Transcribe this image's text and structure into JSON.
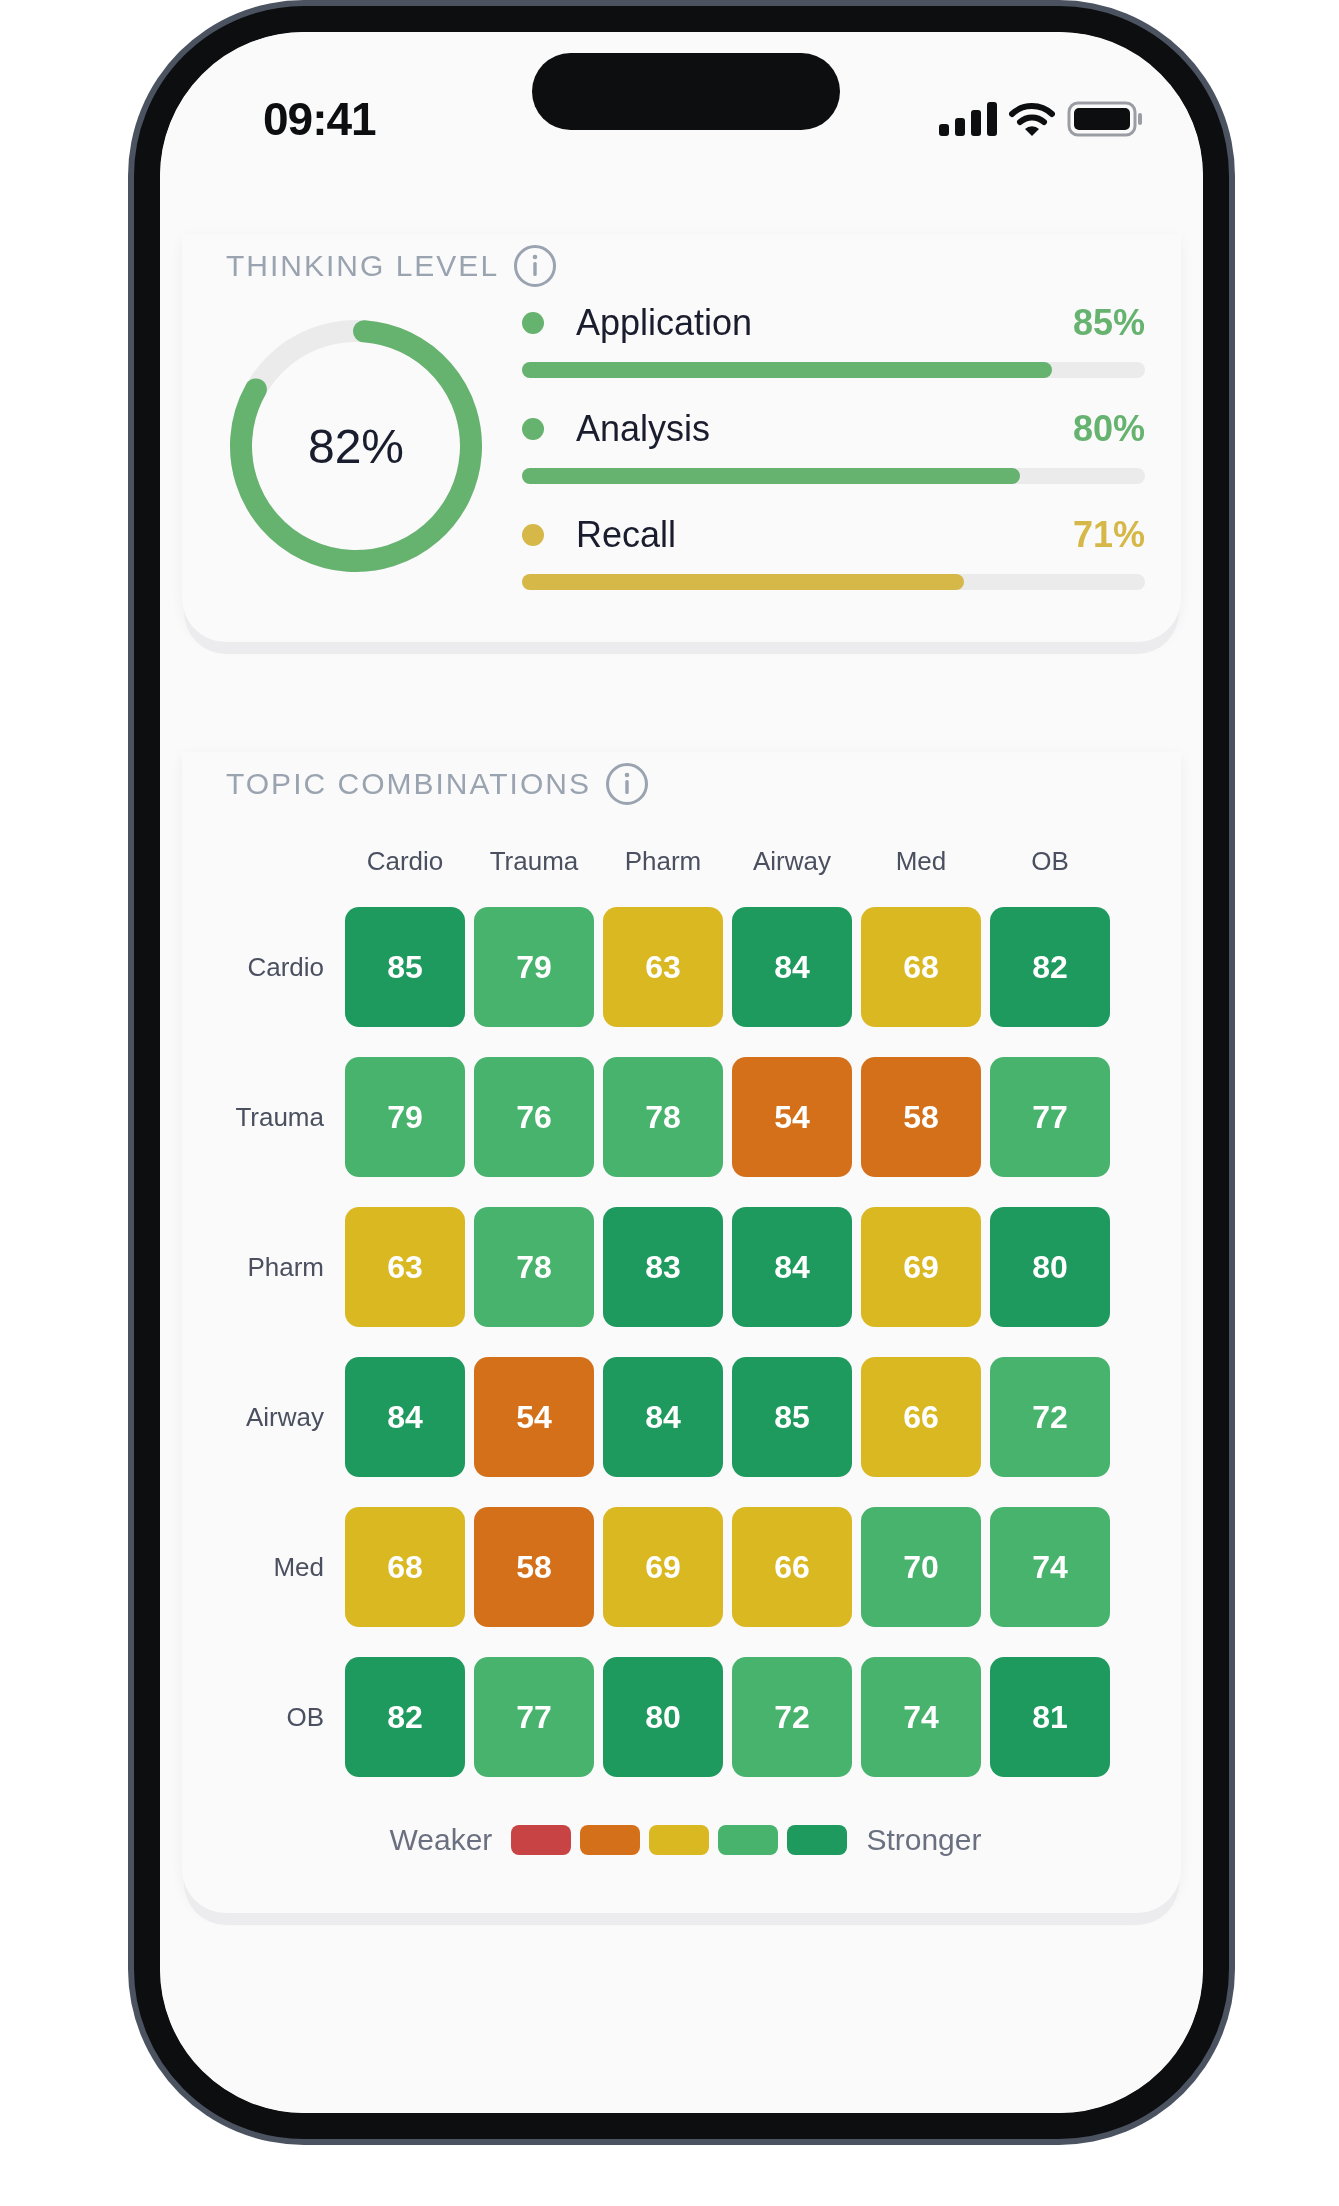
{
  "status_bar": {
    "time": "09:41"
  },
  "thinking_level": {
    "title": "THINKING LEVEL",
    "overall": {
      "label": "82%",
      "level": 0.82
    },
    "items": [
      {
        "label": "Application",
        "value": "85%",
        "level": 0.85,
        "color": "#66b26f"
      },
      {
        "label": "Analysis",
        "value": "80%",
        "level": 0.8,
        "color": "#66b26f"
      },
      {
        "label": "Recall",
        "value": "71%",
        "level": 0.71,
        "color": "#d6b848"
      }
    ]
  },
  "topic_combinations": {
    "title": "TOPIC COMBINATIONS",
    "columns": [
      "Cardio",
      "Trauma",
      "Pharm",
      "Airway",
      "Med",
      "OB"
    ],
    "rows": [
      {
        "label": "Cardio",
        "cells": [
          {
            "value": "85",
            "color": "#1e9a5e"
          },
          {
            "value": "79",
            "color": "#47b36d"
          },
          {
            "value": "63",
            "color": "#d9b822"
          },
          {
            "value": "84",
            "color": "#1e9a5e"
          },
          {
            "value": "68",
            "color": "#d9b822"
          },
          {
            "value": "82",
            "color": "#1e9a5e"
          }
        ]
      },
      {
        "label": "Trauma",
        "cells": [
          {
            "value": "79",
            "color": "#47b36d"
          },
          {
            "value": "76",
            "color": "#47b36d"
          },
          {
            "value": "78",
            "color": "#47b36d"
          },
          {
            "value": "54",
            "color": "#d4701a"
          },
          {
            "value": "58",
            "color": "#d4701a"
          },
          {
            "value": "77",
            "color": "#47b36d"
          }
        ]
      },
      {
        "label": "Pharm",
        "cells": [
          {
            "value": "63",
            "color": "#d9b822"
          },
          {
            "value": "78",
            "color": "#47b36d"
          },
          {
            "value": "83",
            "color": "#1e9a5e"
          },
          {
            "value": "84",
            "color": "#1e9a5e"
          },
          {
            "value": "69",
            "color": "#d9b822"
          },
          {
            "value": "80",
            "color": "#1e9a5e"
          }
        ]
      },
      {
        "label": "Airway",
        "cells": [
          {
            "value": "84",
            "color": "#1e9a5e"
          },
          {
            "value": "54",
            "color": "#d4701a"
          },
          {
            "value": "84",
            "color": "#1e9a5e"
          },
          {
            "value": "85",
            "color": "#1e9a5e"
          },
          {
            "value": "66",
            "color": "#d9b822"
          },
          {
            "value": "72",
            "color": "#47b36d"
          }
        ]
      },
      {
        "label": "Med",
        "cells": [
          {
            "value": "68",
            "color": "#d9b822"
          },
          {
            "value": "58",
            "color": "#d4701a"
          },
          {
            "value": "69",
            "color": "#d9b822"
          },
          {
            "value": "66",
            "color": "#d9b822"
          },
          {
            "value": "70",
            "color": "#47b36d"
          },
          {
            "value": "74",
            "color": "#47b36d"
          }
        ]
      },
      {
        "label": "OB",
        "cells": [
          {
            "value": "82",
            "color": "#1e9a5e"
          },
          {
            "value": "77",
            "color": "#47b36d"
          },
          {
            "value": "80",
            "color": "#1e9a5e"
          },
          {
            "value": "72",
            "color": "#47b36d"
          },
          {
            "value": "74",
            "color": "#47b36d"
          },
          {
            "value": "81",
            "color": "#1e9a5e"
          }
        ]
      }
    ],
    "legend": {
      "low_label": "Weaker",
      "high_label": "Stronger",
      "swatches": [
        {
          "color": "#c84444"
        },
        {
          "color": "#d4701a"
        },
        {
          "color": "#d9b822"
        },
        {
          "color": "#47b36d"
        },
        {
          "color": "#1e9a5e"
        }
      ]
    }
  }
}
